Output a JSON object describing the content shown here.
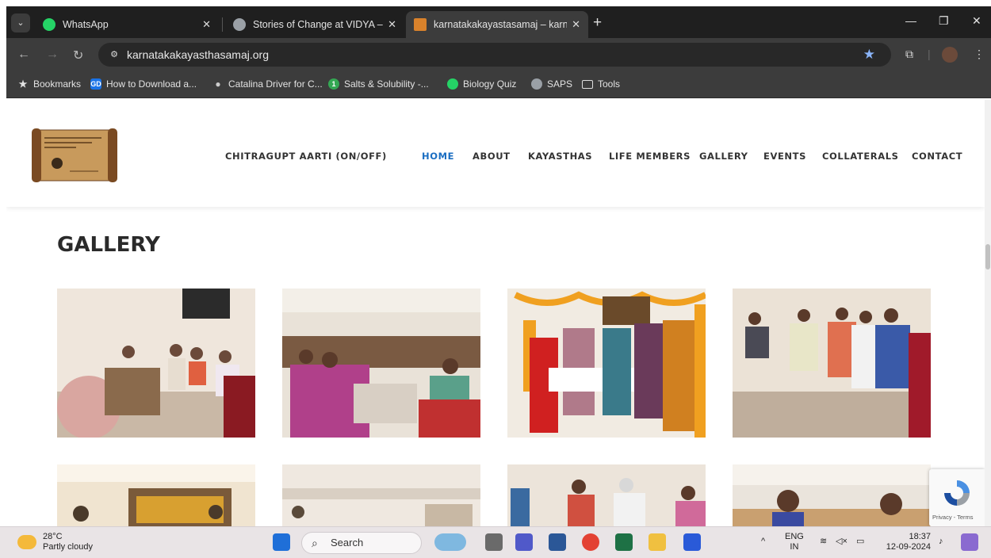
{
  "browser": {
    "tabs": [
      {
        "label": "WhatsApp",
        "favicon": "whatsapp-icon",
        "color": "#25d366"
      },
      {
        "label": "Stories of Change at VIDYA – Vi",
        "favicon": "globe-icon",
        "color": "#9aa0a6"
      },
      {
        "label": "karnatakakayastasamaj – karna",
        "favicon": "site-icon",
        "color": "#d9822b"
      }
    ],
    "url": "karnatakakayasthasamaj.org",
    "bookmarks": [
      {
        "label": "Bookmarks",
        "icon": "star-icon"
      },
      {
        "label": "How to Download a...",
        "icon": "gd-icon"
      },
      {
        "label": "Catalina Driver for C...",
        "icon": "apple-icon"
      },
      {
        "label": "Salts & Solubility -...",
        "icon": "number-one-icon"
      },
      {
        "label": "Biology Quiz",
        "icon": "whatsapp-icon"
      },
      {
        "label": "SAPS",
        "icon": "globe-icon"
      },
      {
        "label": "Tools",
        "icon": "folder-icon"
      }
    ]
  },
  "site": {
    "nav": [
      {
        "label": "CHITRAGUPT AARTI (ON/OFF)",
        "active": false
      },
      {
        "label": "HOME",
        "active": true
      },
      {
        "label": "ABOUT",
        "active": false
      },
      {
        "label": "KAYASTHAS",
        "active": false
      },
      {
        "label": "LIFE MEMBERS",
        "active": false
      },
      {
        "label": "GALLERY",
        "active": false
      },
      {
        "label": "EVENTS",
        "active": false
      },
      {
        "label": "COLLATERALS",
        "active": false
      },
      {
        "label": "CONTACT",
        "active": false
      }
    ],
    "accent_color": "#1b6ec2",
    "page_title": "GALLERY",
    "recaptcha_terms": "Privacy - Terms"
  },
  "taskbar": {
    "temperature": "28°C",
    "weather": "Partly cloudy",
    "search": "Search",
    "language": "ENG",
    "region": "IN",
    "time": "18:37",
    "date": "12-09-2024"
  }
}
